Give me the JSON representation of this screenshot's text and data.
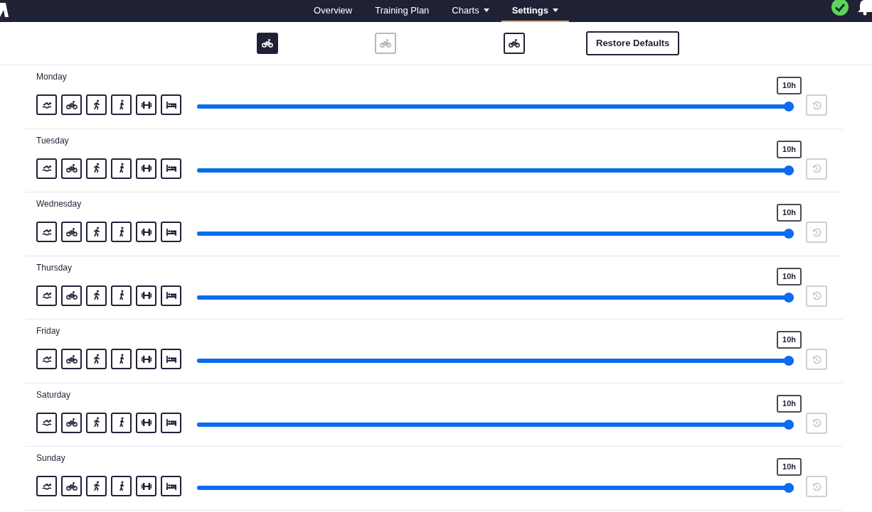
{
  "nav": {
    "items": [
      {
        "label": "Overview",
        "selected": false,
        "has_menu": false
      },
      {
        "label": "Training Plan",
        "selected": false,
        "has_menu": false
      },
      {
        "label": "Charts",
        "selected": false,
        "has_menu": true
      },
      {
        "label": "Settings",
        "selected": true,
        "has_menu": true
      }
    ]
  },
  "toolbar": {
    "bike_buttons": [
      {
        "selected": true,
        "disabled": false
      },
      {
        "selected": false,
        "disabled": true
      },
      {
        "selected": false,
        "disabled": false
      }
    ],
    "restore_button": "Restore Defaults"
  },
  "days": [
    {
      "name": "Monday",
      "level": 1,
      "reading": "10h",
      "reset_disabled": true
    },
    {
      "name": "Tuesday",
      "level": 1,
      "reading": "10h",
      "reset_disabled": true
    },
    {
      "name": "Wednesday",
      "level": 1,
      "reading": "10h",
      "reset_disabled": true
    },
    {
      "name": "Thursday",
      "level": 1,
      "reading": "10h",
      "reset_disabled": true
    },
    {
      "name": "Friday",
      "level": 1,
      "reading": "10h",
      "reset_disabled": true
    },
    {
      "name": "Saturday",
      "level": 1,
      "reading": "10h",
      "reset_disabled": true
    },
    {
      "name": "Sunday",
      "level": 1,
      "reading": "10h",
      "reset_disabled": true
    }
  ],
  "activities": [
    {
      "kind": "swim"
    },
    {
      "kind": "bike"
    },
    {
      "kind": "run"
    },
    {
      "kind": "walk"
    },
    {
      "kind": "strength"
    },
    {
      "kind": "rest"
    }
  ]
}
